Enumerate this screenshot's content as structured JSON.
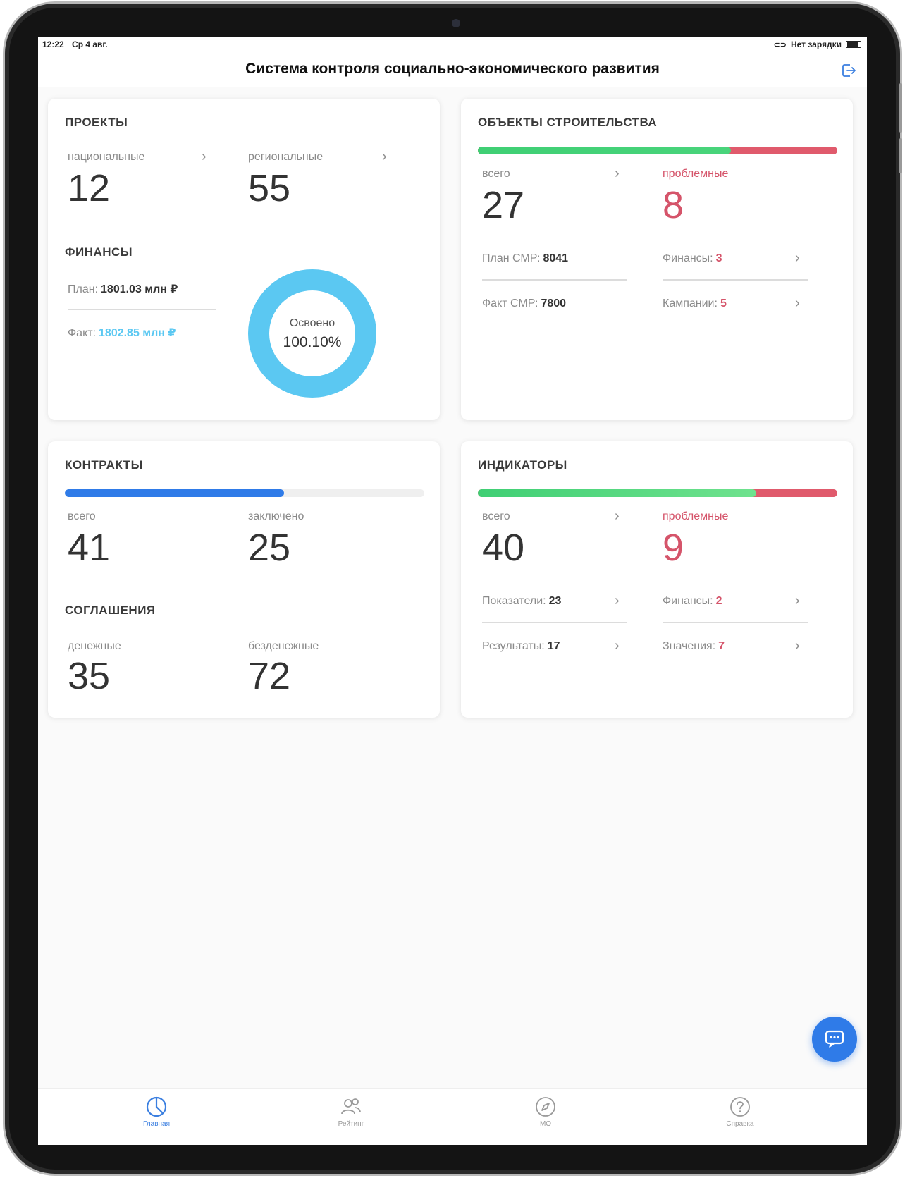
{
  "statusbar": {
    "time": "12:22",
    "date": "Ср 4 авг.",
    "charging": "Нет зарядки"
  },
  "header": {
    "title": "Система контроля социально-экономического развития"
  },
  "projects": {
    "title": "ПРОЕКТЫ",
    "national_label": "национальные",
    "national_value": "12",
    "regional_label": "региональные",
    "regional_value": "55"
  },
  "finance": {
    "title": "ФИНАНСЫ",
    "plan_label": "План:",
    "plan_value": "1801.03 млн ₽",
    "fact_label": "Факт:",
    "fact_value": "1802.85 млн ₽",
    "donut_label": "Освоено",
    "donut_value": "100.10%",
    "donut_fraction": 1.0
  },
  "construction": {
    "title": "ОБЪЕКТЫ СТРОИТЕЛЬСТВА",
    "bar_ok_fraction": 0.704,
    "total_label": "всего",
    "total_value": "27",
    "problem_label": "проблемные",
    "problem_value": "8",
    "plan_smr_label": "План СМР:",
    "plan_smr_value": "8041",
    "fact_smr_label": "Факт СМР:",
    "fact_smr_value": "7800",
    "finance_label": "Финансы:",
    "finance_value": "3",
    "campaigns_label": "Кампании:",
    "campaigns_value": "5"
  },
  "contracts": {
    "title": "КОНТРАКТЫ",
    "bar_fraction": 0.61,
    "total_label": "всего",
    "total_value": "41",
    "signed_label": "заключено",
    "signed_value": "25"
  },
  "agreements": {
    "title": "СОГЛАШЕНИЯ",
    "monetary_label": "денежные",
    "monetary_value": "35",
    "nonmonetary_label": "безденежные",
    "nonmonetary_value": "72"
  },
  "indicators": {
    "title": "ИНДИКАТОРЫ",
    "bar_ok_fraction": 0.775,
    "total_label": "всего",
    "total_value": "40",
    "problem_label": "проблемные",
    "problem_value": "9",
    "metrics_label": "Показатели:",
    "metrics_value": "23",
    "results_label": "Результаты:",
    "results_value": "17",
    "finance_label": "Финансы:",
    "finance_value": "2",
    "values_label": "Значения:",
    "values_value": "7"
  },
  "tabs": [
    {
      "label": "Главная",
      "icon": "pie-chart-icon"
    },
    {
      "label": "Рейтинг",
      "icon": "users-icon"
    },
    {
      "label": "МО",
      "icon": "compass-icon"
    },
    {
      "label": "Справка",
      "icon": "help-icon"
    }
  ],
  "colors": {
    "green": "#3fcf74",
    "red": "#e05a6c",
    "blue": "#2f7be8",
    "cyan": "#5bc8f2",
    "problem_text": "#d5546a"
  }
}
